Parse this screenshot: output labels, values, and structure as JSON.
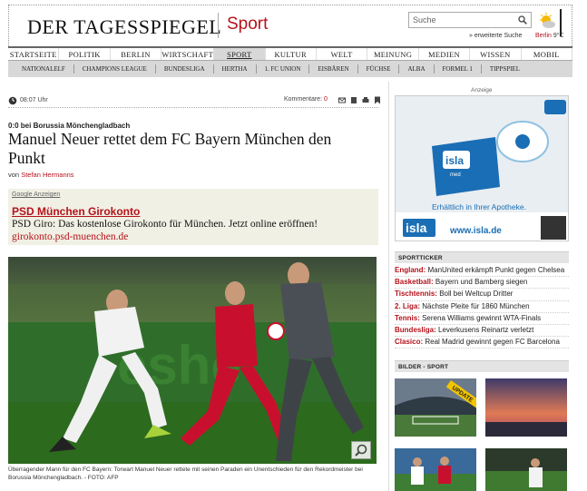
{
  "header": {
    "logo": "DER TAGESSPIEGEL",
    "section": "Sport",
    "search_placeholder": "Suche",
    "extended_search": "» erweiterte Suche",
    "weather_city": "Berlin",
    "weather_temp": "9°C"
  },
  "nav": {
    "items": [
      "STARTSEITE",
      "POLITIK",
      "BERLIN",
      "WIRTSCHAFT",
      "SPORT",
      "KULTUR",
      "WELT",
      "MEINUNG",
      "MEDIEN",
      "WISSEN",
      "MOBIL"
    ],
    "active": "SPORT"
  },
  "subnav": {
    "items": [
      "NATIONALELF",
      "CHAMPIONS LEAGUE",
      "BUNDESLIGA",
      "HERTHA",
      "1. FC UNION",
      "EISBÄREN",
      "FÜCHSE",
      "ALBA",
      "FORMEL 1",
      "TIPPSPIEL"
    ]
  },
  "article": {
    "time": "08:07 Uhr",
    "comments_label": "Kommentare:",
    "comments_count": "0",
    "kicker": "0:0 bei Borussia Mönchengladbach",
    "headline": "Manuel Neuer rettet dem FC Bayern München den Punkt",
    "byline_prefix": "von",
    "author": "Stefan Hermanns",
    "caption": "Überragender Mann für den FC Bayern: Torwart Manuel Neuer rettete mit seinen Paraden ein Unentschieden für den Rekordmeister bei Borussia Mönchengladbach. - FOTO: AFP"
  },
  "google_ad": {
    "label": "Google Anzeigen",
    "title": "PSD München Girokonto",
    "text": "PSD Giro: Das kostenlose Girokonto für München. Jetzt online eröffnen!",
    "url": "girokonto.psd-muenchen.de"
  },
  "sidebar": {
    "ad_label": "Anzeige",
    "isla_tagline": "Erhältlich in Ihrer Apotheke.",
    "isla_url": "www.isla.de",
    "isla_brand": "isla",
    "isla_sub": "med",
    "ticker_title": "SPORTTICKER",
    "ticker": [
      {
        "cat": "England:",
        "text": "ManUnited erkämpft Punkt gegen Chelsea"
      },
      {
        "cat": "Basketball:",
        "text": "Bayern und Bamberg siegen"
      },
      {
        "cat": "Tischtennis:",
        "text": "Boll bei Weltcup Dritter"
      },
      {
        "cat": "2. Liga:",
        "text": "Nächste Pleite für 1860 München"
      },
      {
        "cat": "Tennis:",
        "text": "Serena Williams gewinnt WTA-Finals"
      },
      {
        "cat": "Bundesliga:",
        "text": "Leverkusens Reinartz verletzt"
      },
      {
        "cat": "Clasico:",
        "text": "Real Madrid gewinnt gegen FC Barcelona"
      }
    ],
    "gallery_title": "BILDER - SPORT",
    "gallery_badge": "UPDATE"
  },
  "colors": {
    "accent": "#b5121b",
    "nav_active": "#d8d8d8",
    "ad_bg": "#f1f0e4"
  }
}
